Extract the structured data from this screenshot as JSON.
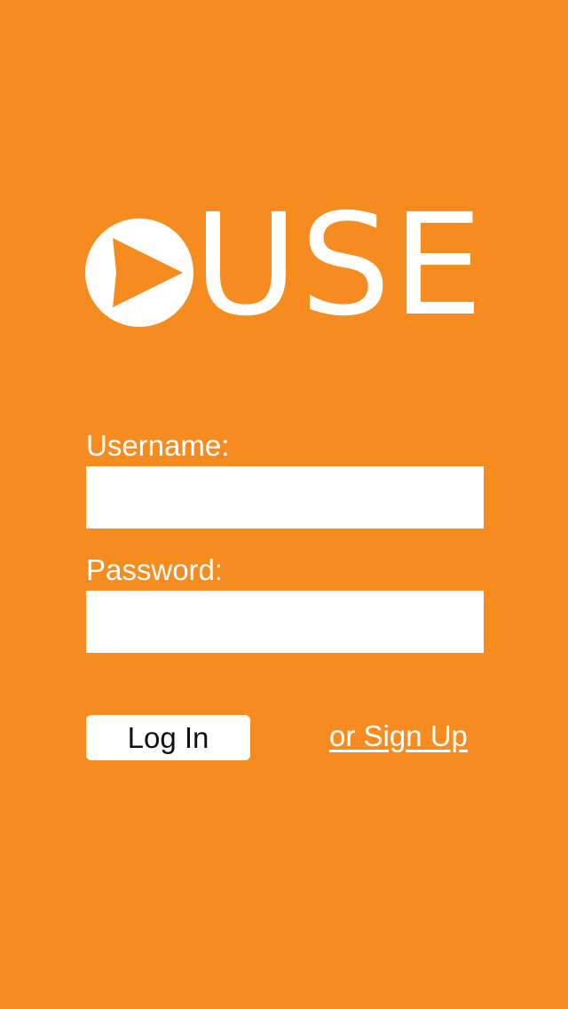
{
  "app": {
    "logo_text": "USE",
    "logo_icon": "play-arrow-circle-icon"
  },
  "form": {
    "username_label": "Username:",
    "username_value": "",
    "password_label": "Password:",
    "password_value": ""
  },
  "actions": {
    "login_label": "Log In",
    "signup_label": "or Sign Up"
  },
  "colors": {
    "background": "#f68b1f",
    "foreground": "#ffffff",
    "button_text": "#111111"
  }
}
